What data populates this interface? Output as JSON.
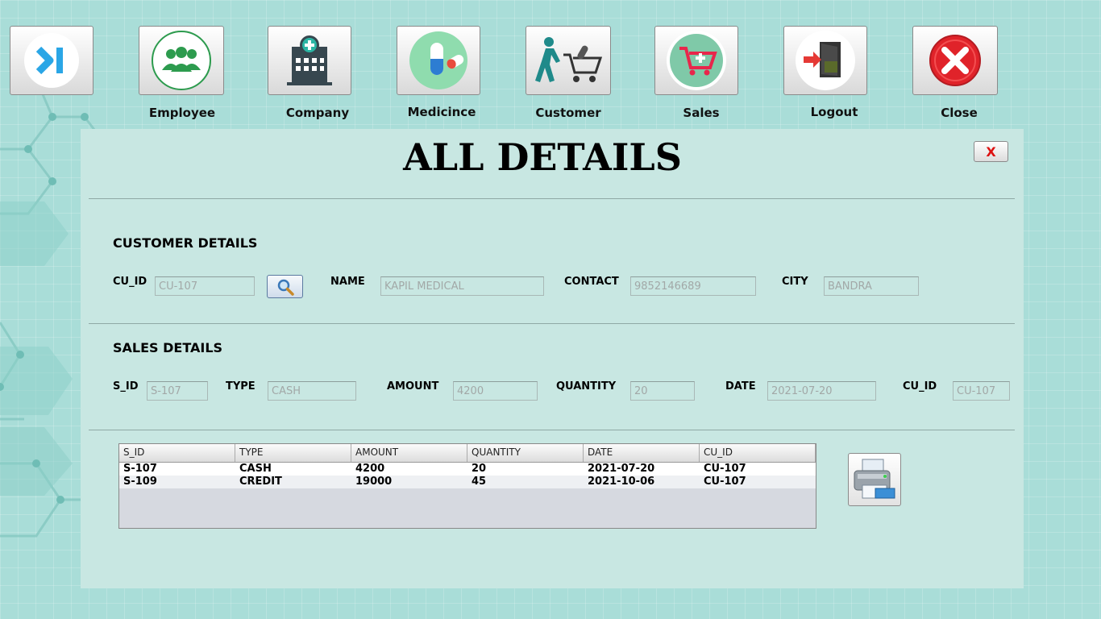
{
  "nav": {
    "items": [
      {
        "label": "",
        "icon": "skip-to-end-icon"
      },
      {
        "label": "Employee",
        "icon": "employees-group-icon"
      },
      {
        "label": "Company",
        "icon": "hospital-building-icon"
      },
      {
        "label": "Medicince",
        "icon": "pill-capsule-icon"
      },
      {
        "label": "Customer",
        "icon": "person-pushing-cart-icon"
      },
      {
        "label": "Sales",
        "icon": "shopping-cart-icon"
      },
      {
        "label": "Logout",
        "icon": "logout-door-icon"
      },
      {
        "label": "Close",
        "icon": "close-red-circle-icon"
      }
    ]
  },
  "page": {
    "title": "ALL DETAILS",
    "close_x": "X"
  },
  "customer": {
    "heading": "CUSTOMER DETAILS",
    "cu_id_label": "CU_ID",
    "cu_id": "CU-107",
    "name_label": "NAME",
    "name": "KAPIL MEDICAL",
    "contact_label": "CONTACT",
    "contact": "9852146689",
    "city_label": "CITY",
    "city": "BANDRA"
  },
  "sales": {
    "heading": "SALES DETAILS",
    "s_id_label": "S_ID",
    "s_id": "S-107",
    "type_label": "TYPE",
    "type": "CASH",
    "amount_label": "AMOUNT",
    "amount": "4200",
    "quantity_label": "QUANTITY",
    "quantity": "20",
    "date_label": "DATE",
    "date": "2021-07-20",
    "cu_id_label": "CU_ID",
    "cu_id": "CU-107"
  },
  "table": {
    "headers": [
      "S_ID",
      "TYPE",
      "AMOUNT",
      "QUANTITY",
      "DATE",
      "CU_ID"
    ],
    "rows": [
      [
        "S-107",
        "CASH",
        "4200",
        "20",
        "2021-07-20",
        "CU-107"
      ],
      [
        "S-109",
        "CREDIT",
        "19000",
        "45",
        "2021-10-06",
        "CU-107"
      ]
    ]
  },
  "colors": {
    "background": "#a9ddd8",
    "panel": "#c8e7e2",
    "accent_red": "#e0232a"
  }
}
